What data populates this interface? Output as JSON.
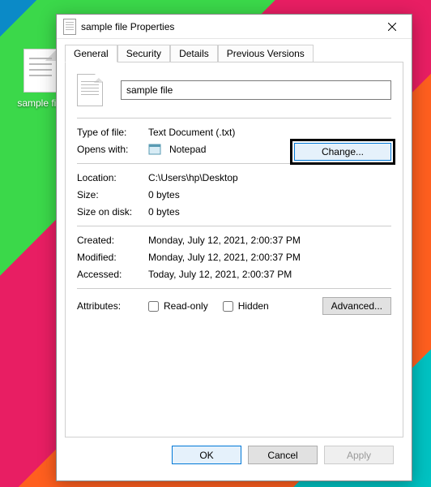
{
  "desktop": {
    "file_label": "sample file"
  },
  "dialog": {
    "title": "sample file Properties",
    "tabs": [
      "General",
      "Security",
      "Details",
      "Previous Versions"
    ],
    "filename": "sample file",
    "type_label": "Type of file:",
    "type_value": "Text Document (.txt)",
    "opens_label": "Opens with:",
    "opens_app": "Notepad",
    "change_btn": "Change...",
    "location_label": "Location:",
    "location_value": "C:\\Users\\hp\\Desktop",
    "size_label": "Size:",
    "size_value": "0 bytes",
    "disk_label": "Size on disk:",
    "disk_value": "0 bytes",
    "created_label": "Created:",
    "created_value": "Monday, July 12, 2021, 2:00:37 PM",
    "modified_label": "Modified:",
    "modified_value": "Monday, July 12, 2021, 2:00:37 PM",
    "accessed_label": "Accessed:",
    "accessed_value": "Today, July 12, 2021, 2:00:37 PM",
    "attributes_label": "Attributes:",
    "readonly_label": "Read-only",
    "hidden_label": "Hidden",
    "advanced_btn": "Advanced...",
    "ok_btn": "OK",
    "cancel_btn": "Cancel",
    "apply_btn": "Apply"
  }
}
